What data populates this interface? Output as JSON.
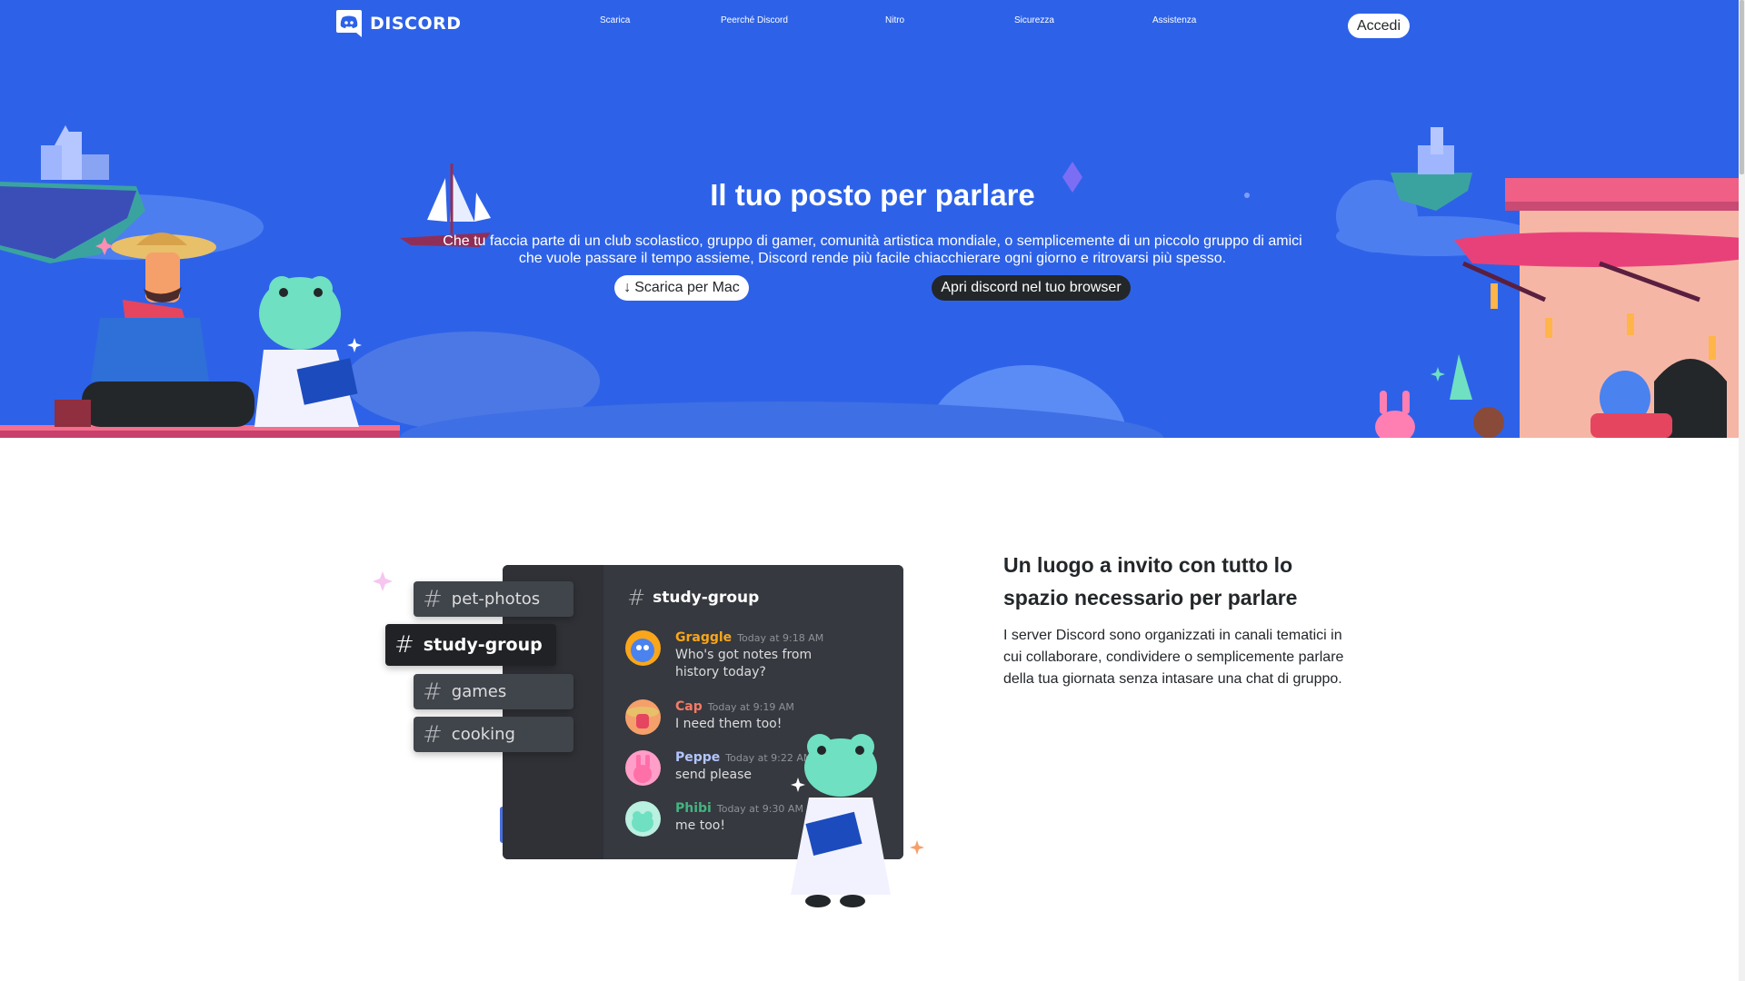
{
  "nav": {
    "brand": "DISCORD",
    "links": [
      "Scarica",
      "Peerché Discord",
      "Nitro",
      "Sicurezza",
      "Assistenza"
    ],
    "login_label": "Accedi"
  },
  "hero": {
    "title": "Il tuo posto per parlare",
    "subtitle_line1": "Che tu faccia parte di un club scolastico, gruppo di gamer, comunità artistica mondiale, o semplicemente di un piccolo gruppo di amici",
    "subtitle_line2": "che vuole passare il tempo assieme, Discord rende più facile chiacchierare ogni giorno e ritrovarsi più spesso.",
    "download_arrow": "↓",
    "download_label": "Scarica per Mac",
    "browser_label": "Apri discord nel tuo browser"
  },
  "mock": {
    "channels": [
      "pet-photos",
      "study-group",
      "games",
      "cooking"
    ],
    "active_channel": "study-group",
    "header_channel": "study-group",
    "messages": [
      {
        "name": "Graggle",
        "time": "Today at 9:18 AM",
        "text_line1": "Who's got notes from",
        "text_line2": "history today?",
        "color": "#faa61a"
      },
      {
        "name": "Cap",
        "time": "Today at 9:19 AM",
        "text_line1": "I need them too!",
        "text_line2": "",
        "color": "#f47b67"
      },
      {
        "name": "Peppe",
        "time": "Today at 9:22 AM",
        "text_line1": "send please",
        "text_line2": "",
        "color": "#b3c5ff"
      },
      {
        "name": "Phibi",
        "time": "Today at 9:30 AM",
        "text_line1": "me too!",
        "text_line2": "",
        "color": "#43b581"
      }
    ]
  },
  "section": {
    "title_line1": "Un luogo a invito con tutto lo",
    "title_line2": "spazio necessario per parlare",
    "text_line1": "I server Discord sono organizzati in canali tematici in",
    "text_line2": "cui collaborare, condividere o semplicemente parlare",
    "text_line3": "della tua giornata senza intasare una chat di gruppo."
  },
  "colors": {
    "hero_blue": "#2d62e8",
    "button_dark": "#23272a",
    "panel_dark": "#36393f"
  }
}
